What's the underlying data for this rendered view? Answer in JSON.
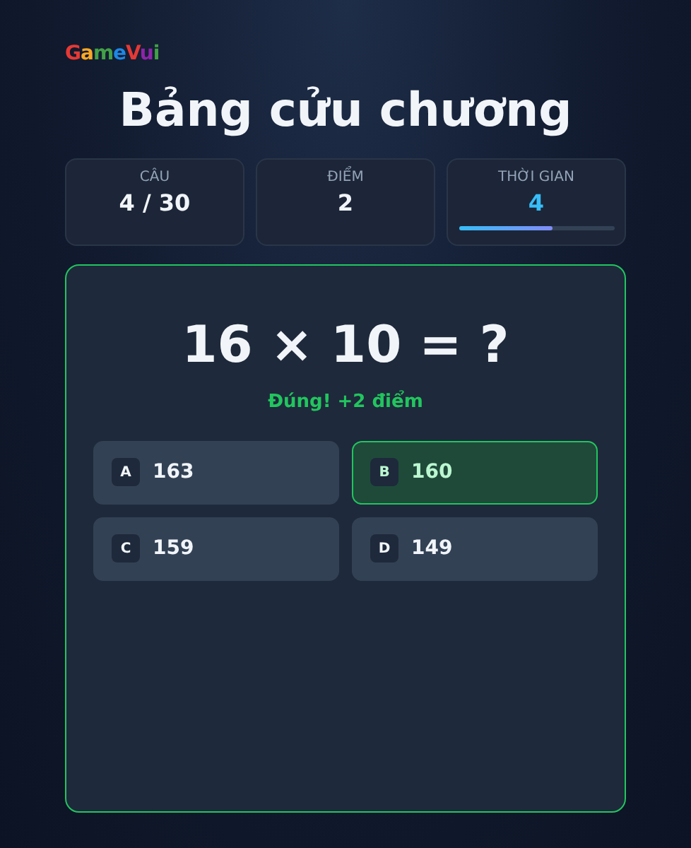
{
  "logo": "GameVui",
  "title": "Bảng cửu chương",
  "stats": [
    {
      "label": "CÂU",
      "value": "4 / 30",
      "kind": "plain"
    },
    {
      "label": "ĐIỂM",
      "value": "2",
      "kind": "plain"
    },
    {
      "label": "THỜI GIAN",
      "value": "4",
      "kind": "timer",
      "level": 0.6
    }
  ],
  "question": "16 × 10 = ?",
  "feedback": "Đúng! +2 điểm",
  "answers": [
    {
      "letter": "A",
      "value": "163",
      "correct": false
    },
    {
      "letter": "B",
      "value": "160",
      "correct": true
    },
    {
      "letter": "C",
      "value": "159",
      "correct": false
    },
    {
      "letter": "D",
      "value": "149",
      "correct": false
    }
  ]
}
